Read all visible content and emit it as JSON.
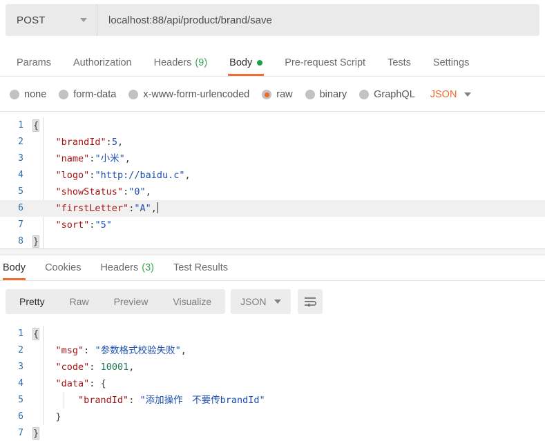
{
  "request": {
    "method": "POST",
    "method_caret_icon": "chevron-down-icon",
    "url": "localhost:88/api/product/brand/save",
    "tabs": [
      {
        "label": "Params",
        "active": false
      },
      {
        "label": "Authorization",
        "active": false
      },
      {
        "label": "Headers",
        "count": "(9)",
        "active": false
      },
      {
        "label": "Body",
        "active": true,
        "dot": true
      },
      {
        "label": "Pre-request Script",
        "active": false
      },
      {
        "label": "Tests",
        "active": false
      },
      {
        "label": "Settings",
        "active": false
      }
    ],
    "body_types": [
      {
        "label": "none",
        "selected": false
      },
      {
        "label": "form-data",
        "selected": false
      },
      {
        "label": "x-www-form-urlencoded",
        "selected": false
      },
      {
        "label": "raw",
        "selected": true
      },
      {
        "label": "binary",
        "selected": false
      },
      {
        "label": "GraphQL",
        "selected": false
      }
    ],
    "format": "JSON",
    "format_caret_icon": "chevron-down-icon",
    "editor": {
      "lines": [
        {
          "num": "1",
          "active": false
        },
        {
          "num": "2",
          "active": false
        },
        {
          "num": "3",
          "active": false
        },
        {
          "num": "4",
          "active": false
        },
        {
          "num": "5",
          "active": true
        },
        {
          "num": "6",
          "active": true
        },
        {
          "num": "7",
          "active": false
        },
        {
          "num": "8",
          "active": false
        }
      ],
      "line_numbers": [
        "1",
        "2",
        "3",
        "4",
        "5",
        "6",
        "7",
        "8"
      ],
      "content": {
        "l1_brace": "{",
        "l2_key": "\"brandId\"",
        "l2_colon": ":",
        "l2_val": "5",
        "l2_comma": ",",
        "l3_key": "\"name\"",
        "l3_colon": ":",
        "l3_val": "\"小米\"",
        "l3_comma": ",",
        "l4_key": "\"logo\"",
        "l4_colon": ":",
        "l4_val": "\"http://baidu.c\"",
        "l4_comma": ",",
        "l5_key": "\"showStatus\"",
        "l5_colon": ":",
        "l5_val": "\"0\"",
        "l5_comma": ",",
        "l6_key": "\"firstLetter\"",
        "l6_colon": ":",
        "l6_val": "\"A\"",
        "l6_comma": ",",
        "l7_key": "\"sort\"",
        "l7_colon": ":",
        "l7_val": "\"5\"",
        "l8_brace": "}"
      },
      "raw_text": "{\n    \"brandId\":5,\n    \"name\":\"小米\",\n    \"logo\":\"http://baidu.c\",\n    \"showStatus\":\"0\",\n    \"firstLetter\":\"A\",\n    \"sort\":\"5\"\n}"
    }
  },
  "response": {
    "tabs": [
      {
        "label": "Body",
        "active": true
      },
      {
        "label": "Cookies",
        "active": false
      },
      {
        "label": "Headers",
        "count": "(3)",
        "active": false
      },
      {
        "label": "Test Results",
        "active": false
      }
    ],
    "view_modes": [
      {
        "label": "Pretty",
        "active": true
      },
      {
        "label": "Raw",
        "active": false
      },
      {
        "label": "Preview",
        "active": false
      },
      {
        "label": "Visualize",
        "active": false
      }
    ],
    "format": "JSON",
    "format_caret_icon": "chevron-down-icon",
    "wrap_icon": "word-wrap-icon",
    "editor": {
      "line_numbers": [
        "1",
        "2",
        "3",
        "4",
        "5",
        "6",
        "7"
      ],
      "content": {
        "l1_brace": "{",
        "l2_key": "\"msg\"",
        "l2_colon": ":",
        "l2_val": "\"参数格式校验失败\"",
        "l2_comma": ",",
        "l3_key": "\"code\"",
        "l3_colon": ":",
        "l3_val": "10001",
        "l3_comma": ",",
        "l4_key": "\"data\"",
        "l4_colon": ":",
        "l4_brace": "{",
        "l5_key": "\"brandId\"",
        "l5_colon": ":",
        "l5_val": "\"添加操作　不要传brandId\"",
        "l6_brace": "}",
        "l7_brace": "}"
      },
      "raw_text": "{\n    \"msg\": \"参数格式校验失败\",\n    \"code\": 10001,\n    \"data\": {\n        \"brandId\": \"添加操作　不要传brandId\"\n    }\n}"
    }
  },
  "colors": {
    "accent_orange": "#ef6c34",
    "badge_green": "#3aa757",
    "dot_green": "#1fa14d",
    "json_key": "#a31515",
    "json_string": "#1d4fb0",
    "json_number_response": "#1b7a50",
    "gutter_blue": "#2b6cb0",
    "toolbar_gray": "#ececec"
  }
}
